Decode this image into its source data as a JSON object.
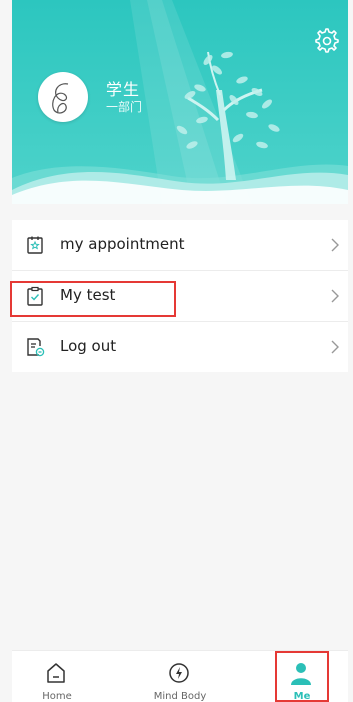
{
  "header": {
    "user_name": "学生",
    "department": "一部门",
    "accent": "#2cc6bf"
  },
  "menu": {
    "items": [
      {
        "label": "my appointment",
        "icon": "calendar-star-icon"
      },
      {
        "label": "My test",
        "icon": "clipboard-check-icon"
      },
      {
        "label": "Log out",
        "icon": "document-logout-icon"
      }
    ]
  },
  "nav": {
    "tabs": [
      {
        "label": "Home",
        "icon": "home-icon"
      },
      {
        "label": "Mind Body",
        "icon": "energy-icon"
      },
      {
        "label": "Me",
        "icon": "person-icon",
        "active": true
      }
    ]
  },
  "colors": {
    "highlight": "#e53935",
    "active_tab": "#2bbfb7"
  }
}
